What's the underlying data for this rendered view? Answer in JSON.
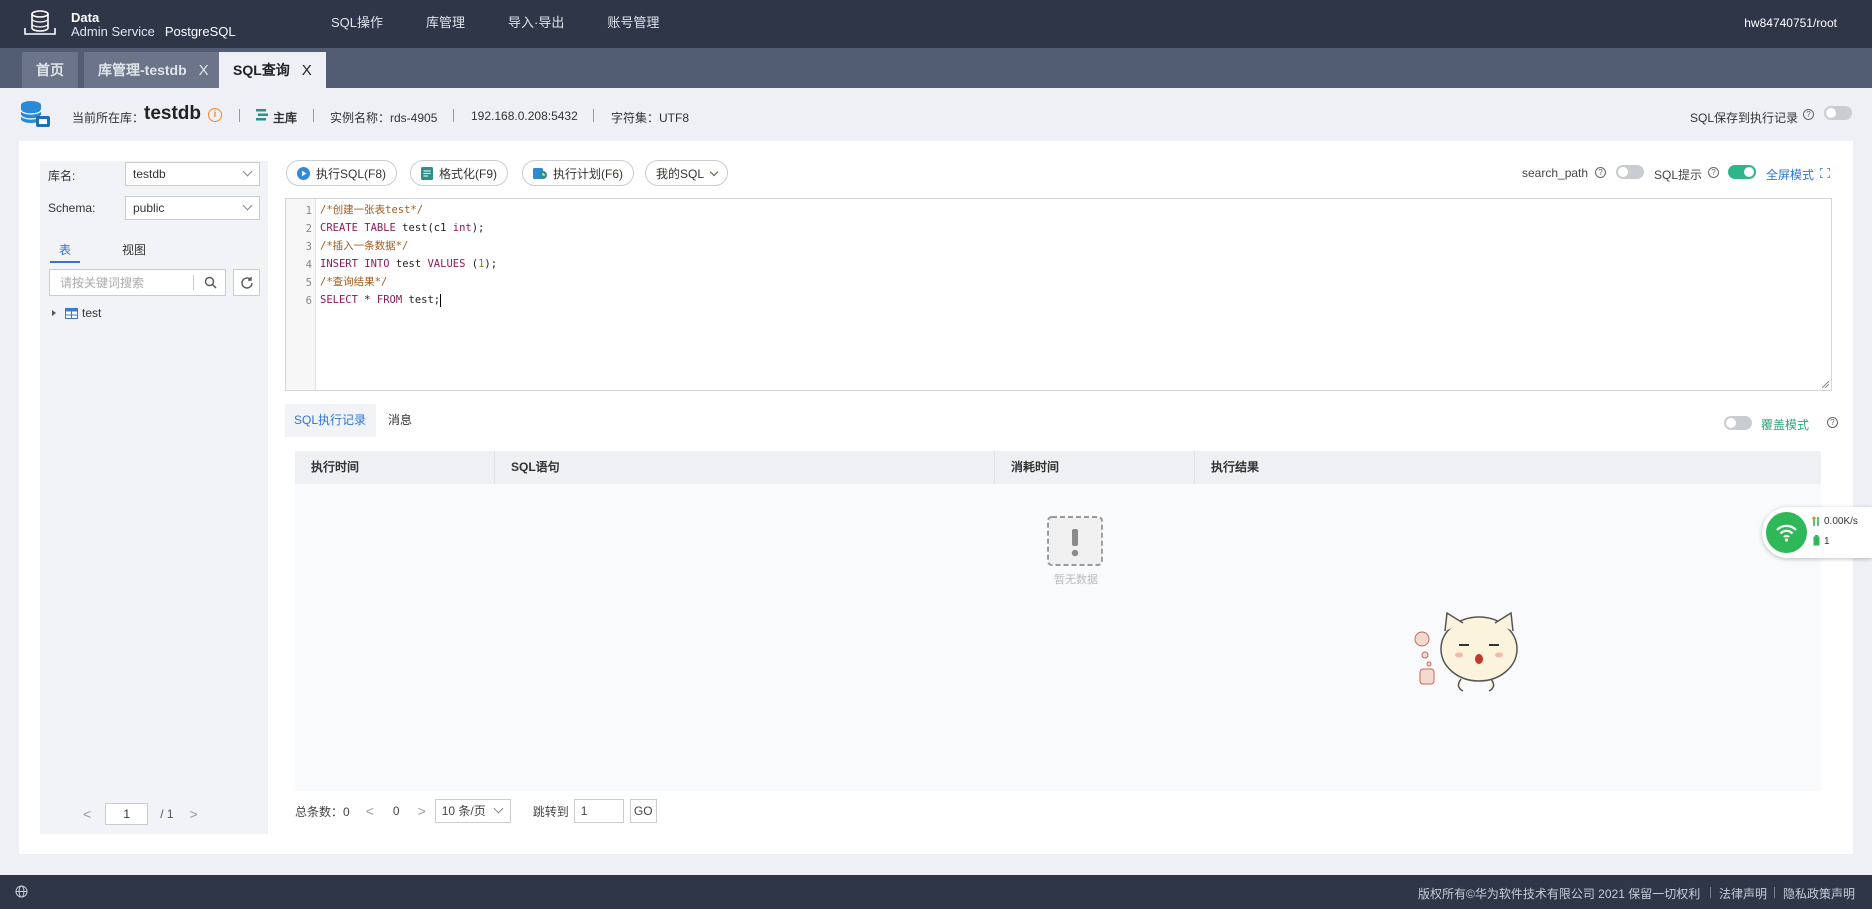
{
  "brand": {
    "line1": "Data",
    "line2": "Admin Service",
    "engine": "PostgreSQL"
  },
  "topnav": {
    "items": [
      "SQL操作",
      "库管理",
      "导入·导出",
      "账号管理"
    ],
    "user": "hw84740751/root"
  },
  "tabs": [
    {
      "label": "首页",
      "closable": false
    },
    {
      "label": "库管理-testdb",
      "closable": true
    },
    {
      "label": "SQL查询",
      "closable": true,
      "active": true
    }
  ],
  "tab_close_glyph": "X",
  "infobar": {
    "current_db_label": "当前所在库：",
    "current_db": "testdb",
    "role": "主库",
    "instance": "实例名称：rds-4905",
    "address": "192.168.0.208:5432",
    "charset": "字符集：UTF8",
    "save_history_label": "SQL保存到执行记录"
  },
  "sidebar": {
    "db_label": "库名:",
    "db_value": "testdb",
    "schema_label": "Schema:",
    "schema_value": "public",
    "tabs": [
      "表",
      "视图"
    ],
    "search_placeholder": "请按关键词搜索",
    "tree": [
      {
        "label": "test"
      }
    ],
    "pager": {
      "prev": "<",
      "page": "1",
      "total": "/ 1",
      "next": ">"
    }
  },
  "toolbar": {
    "run": "执行SQL(F8)",
    "format": "格式化(F9)",
    "plan": "执行计划(F6)",
    "my_sql": "我的SQL",
    "search_path": "search_path",
    "sql_hint": "SQL提示",
    "fullscreen": "全屏模式"
  },
  "editor": {
    "lines": [
      {
        "n": "1",
        "parts": [
          {
            "t": "/*创建一张表test*/",
            "c": "comment"
          }
        ]
      },
      {
        "n": "2",
        "parts": [
          {
            "t": "CREATE TABLE",
            "c": "kw"
          },
          {
            "t": " test(c1 ",
            "c": "plain"
          },
          {
            "t": "int",
            "c": "kw"
          },
          {
            "t": ");",
            "c": "plain"
          }
        ]
      },
      {
        "n": "3",
        "parts": [
          {
            "t": "/*插入一条数据*/",
            "c": "comment"
          }
        ]
      },
      {
        "n": "4",
        "parts": [
          {
            "t": "INSERT INTO",
            "c": "kw"
          },
          {
            "t": " test ",
            "c": "plain"
          },
          {
            "t": "VALUES",
            "c": "kw"
          },
          {
            "t": " (",
            "c": "plain"
          },
          {
            "t": "1",
            "c": "num"
          },
          {
            "t": ");",
            "c": "plain"
          }
        ]
      },
      {
        "n": "5",
        "parts": [
          {
            "t": "/*查询结果*/",
            "c": "comment"
          }
        ]
      },
      {
        "n": "6",
        "parts": [
          {
            "t": "SELECT",
            "c": "kw"
          },
          {
            "t": " * ",
            "c": "plain"
          },
          {
            "t": "FROM",
            "c": "kw"
          },
          {
            "t": " test;",
            "c": "plain"
          }
        ]
      }
    ]
  },
  "results": {
    "tabs": [
      "SQL执行记录",
      "消息"
    ],
    "cover_mode": "覆盖模式",
    "columns": [
      "执行时间",
      "SQL语句",
      "消耗时间",
      "执行结果"
    ],
    "empty": "暂无数据"
  },
  "pager": {
    "total": "总条数：0",
    "page": "0",
    "per_page": "10 条/页",
    "goto_label": "跳转到",
    "goto_value": "1",
    "go": "GO"
  },
  "net_widget": {
    "speed": "0.00K/s",
    "count": "1"
  },
  "footer": {
    "copyright": "版权所有©华为软件技术有限公司 2021 保留一切权利",
    "legal": "法律声明",
    "privacy": "隐私政策声明"
  },
  "colors": {
    "nav_bg": "#2f3648",
    "tab_bg": "#525c72",
    "accent_blue": "#2f75d6",
    "toggle_on": "#2fb58b",
    "comment": "#a45b1d",
    "keyword": "#8e1b58"
  }
}
